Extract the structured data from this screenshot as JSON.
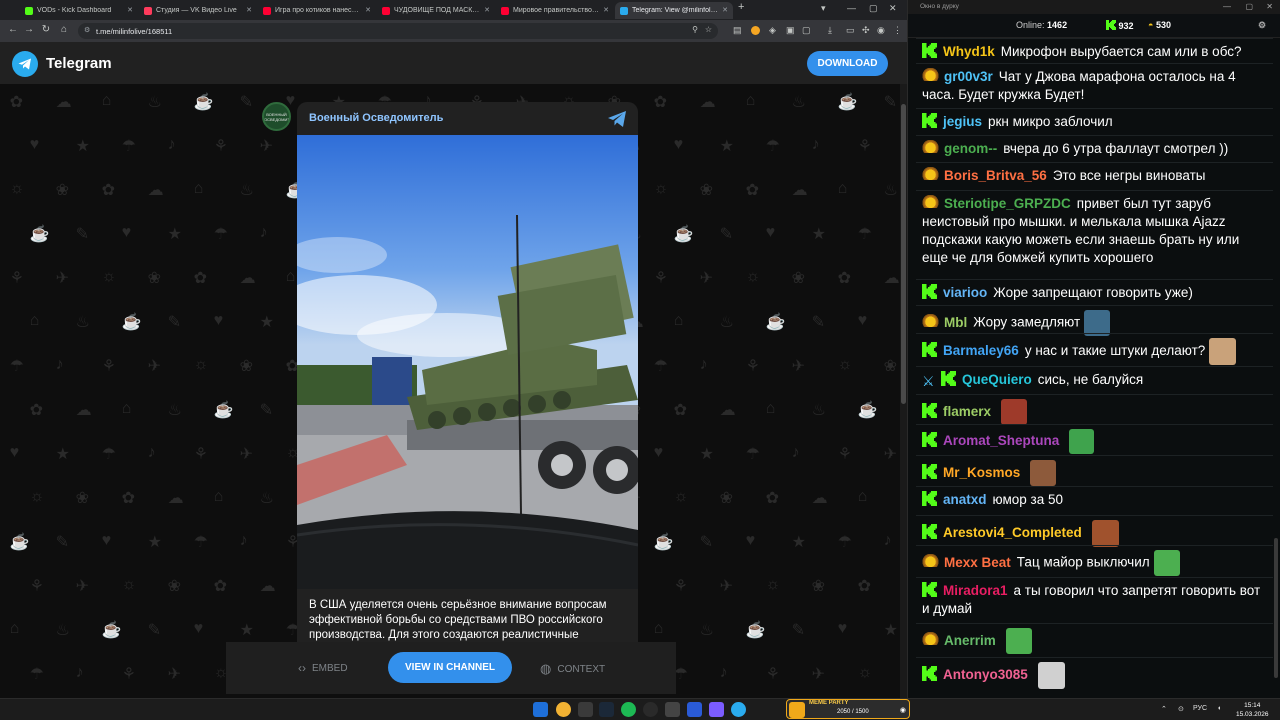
{
  "browser": {
    "tabs": [
      {
        "label": "VODs - Kick Dashboard",
        "color": "#53fc18"
      },
      {
        "label": "Студия — VK Видео Live",
        "color": "#ff3b5c"
      },
      {
        "label": "Игра про котиков нанесла м",
        "color": "#ff0033"
      },
      {
        "label": "ЧУДОВИЩЕ ПОД МАСКОЙ Д",
        "color": "#ff0033"
      },
      {
        "label": "Мировое правительство это",
        "color": "#ff0033"
      },
      {
        "label": "Telegram: View @milinfolive",
        "color": "#2aabee"
      }
    ],
    "new_tab": "+",
    "url": "t.me/milinfolive/168511"
  },
  "telegram": {
    "brand": "Telegram",
    "download": "DOWNLOAD",
    "channel_name": "Военный Осведомитель",
    "avatar_text": "ВОЕННЫЙ ОСВЕДОМИТЕЛЬ",
    "post_text": "В США уделяется очень серьёзное внимание вопросам эффективной борьбы со средствами ПВО российского производства. Для этого создаются реалистичные",
    "actions": {
      "embed": "EMBED",
      "view": "VIEW IN CHANNEL",
      "context": "CONTEXT"
    }
  },
  "chat": {
    "window_title": "Окно в дурку",
    "online_label": "Online:",
    "online": "1462",
    "kick_count": "932",
    "other_count": "530",
    "messages": [
      {
        "badges": [
          "kick"
        ],
        "user": "Whyd1k",
        "color": "#f5c518",
        "text": "Микрофон вырубается сам или в обс?"
      },
      {
        "badges": [
          "pot"
        ],
        "user": "gr00v3r",
        "color": "#4fc3f7",
        "text": "Чат у Джова марафона осталось на 4 часа. Будет кружка Будет!"
      },
      {
        "badges": [
          "kick"
        ],
        "user": "jegius",
        "color": "#4fc3f7",
        "text": "ркн микро заблочил"
      },
      {
        "badges": [
          "pot"
        ],
        "user": "genom--",
        "color": "#4caf50",
        "text": "вчера до 6 утра фаллаут смотрел ))"
      },
      {
        "badges": [
          "pot"
        ],
        "user": "Boris_Britva_56",
        "color": "#ff7043",
        "text": "Это все негры виноваты"
      },
      {
        "badges": [
          "pot"
        ],
        "user": "Steriotipe_GRPZDC",
        "color": "#4caf50",
        "text": "привет был тут заруб неистовый про мышки. и мелькала мышка Ajazz подскажи какую можеть если знаешь брать ну или еще че для бомжей купить хорошего"
      },
      {
        "badges": [
          "kick"
        ],
        "user": "viarioo",
        "color": "#64b5f6",
        "text": "Жоре запрещают говорить уже)"
      },
      {
        "badges": [
          "pot"
        ],
        "user": "Mbl",
        "color": "#9ccc65",
        "text": "Жору замедляют",
        "emote": "#3d6b8a"
      },
      {
        "badges": [
          "kick"
        ],
        "user": "Barmaley66",
        "color": "#42a5f5",
        "text": "у нас и такие штуки делают?",
        "emote": "#c9a27a"
      },
      {
        "badges": [
          "sword",
          "kick"
        ],
        "user": "QueQuiero",
        "color": "#26c6da",
        "text": "сись, не балуйся"
      },
      {
        "badges": [
          "kick"
        ],
        "user": "flamerx",
        "color": "#9ccc65",
        "text": "",
        "emote": "#9e3a2a"
      },
      {
        "badges": [
          "kick"
        ],
        "user": "Aromat_Sheptuna",
        "color": "#ab47bc",
        "text": "",
        "emote": "#3fa34d"
      },
      {
        "badges": [
          "kick"
        ],
        "user": "Mr_Kosmos",
        "color": "#ffa726",
        "text": "",
        "emote": "#8d5a3b"
      },
      {
        "badges": [
          "kick"
        ],
        "user": "anatxd",
        "color": "#64b5f6",
        "text": "юмор за 50"
      },
      {
        "badges": [
          "kick"
        ],
        "user": "Arestovi4_Completed",
        "color": "#ffca28",
        "text": "",
        "emote": "#a0522d"
      },
      {
        "badges": [
          "pot"
        ],
        "user": "Mexx Beat",
        "color": "#ff7043",
        "text": "Тац майор выключил",
        "emote": "#4caf50"
      },
      {
        "badges": [
          "kick"
        ],
        "user": "Miradora1",
        "color": "#e91e63",
        "text": "а ты говорил что запретят говорить вот и думай"
      },
      {
        "badges": [
          "pot"
        ],
        "user": "Anerrim",
        "color": "#66bb6a",
        "text": "",
        "emote": "#4caf50"
      },
      {
        "badges": [
          "kick"
        ],
        "user": "Antonyo3085",
        "color": "#f06292",
        "text": "",
        "emote": "#d0d0d0"
      }
    ]
  },
  "taskbar": {
    "meme_title": "MEME PARTY",
    "meme_count": "2050 / 1500",
    "lang": "РУС",
    "time": "15:14",
    "date": "15.03.2026"
  },
  "colors": {
    "telegram_blue": "#3390ec",
    "kick_green": "#53fc18"
  }
}
